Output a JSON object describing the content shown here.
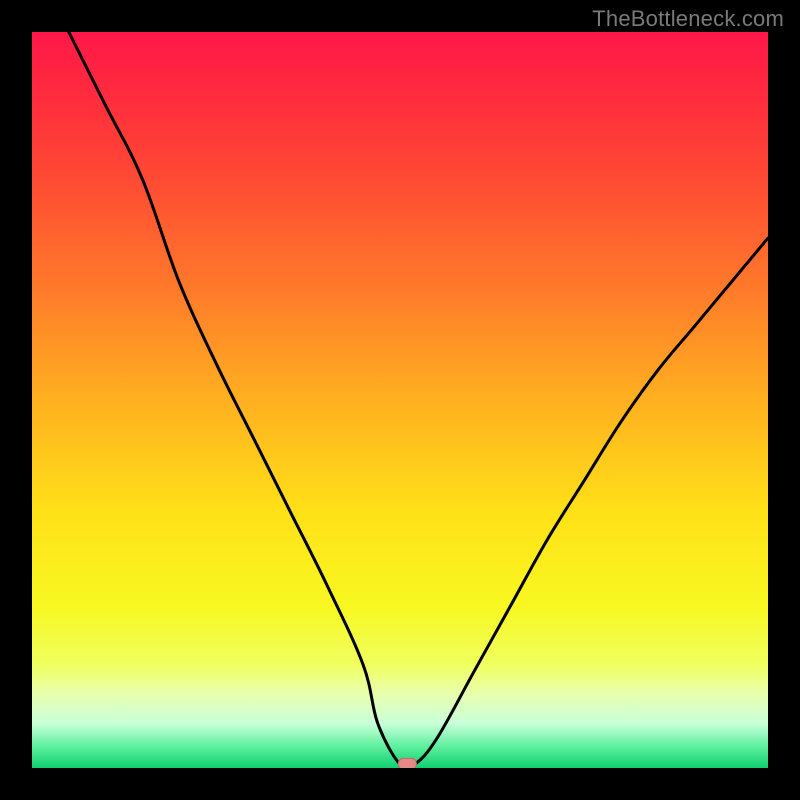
{
  "watermark": "TheBottleneck.com",
  "marker": {
    "fill": "#e58a8a",
    "stroke": "#c46666"
  },
  "chart_data": {
    "type": "line",
    "title": "",
    "xlabel": "",
    "ylabel": "",
    "xlim": [
      0,
      100
    ],
    "ylim": [
      0,
      100
    ],
    "grid": false,
    "x": [
      5,
      10,
      15,
      20,
      25,
      30,
      35,
      40,
      45,
      47,
      50,
      52,
      55,
      60,
      65,
      70,
      75,
      80,
      85,
      90,
      95,
      100
    ],
    "values": [
      100,
      90,
      80,
      66,
      55,
      45,
      35,
      25,
      14,
      6,
      0.5,
      0.5,
      4,
      13,
      22,
      31,
      39,
      47,
      54,
      60,
      66,
      72
    ],
    "marker_point": {
      "x": 51,
      "y": 0.5
    },
    "gradient_stops": [
      {
        "offset": 0.0,
        "color": "#ff1848"
      },
      {
        "offset": 0.08,
        "color": "#ff2a3e"
      },
      {
        "offset": 0.2,
        "color": "#ff4a34"
      },
      {
        "offset": 0.35,
        "color": "#ff7a2a"
      },
      {
        "offset": 0.5,
        "color": "#ffb020"
      },
      {
        "offset": 0.65,
        "color": "#ffe018"
      },
      {
        "offset": 0.78,
        "color": "#f8f820"
      },
      {
        "offset": 0.86,
        "color": "#f0ff60"
      },
      {
        "offset": 0.9,
        "color": "#e8ffb0"
      },
      {
        "offset": 0.94,
        "color": "#c8ffd8"
      },
      {
        "offset": 0.97,
        "color": "#60f0a0"
      },
      {
        "offset": 1.0,
        "color": "#10d070"
      }
    ]
  }
}
